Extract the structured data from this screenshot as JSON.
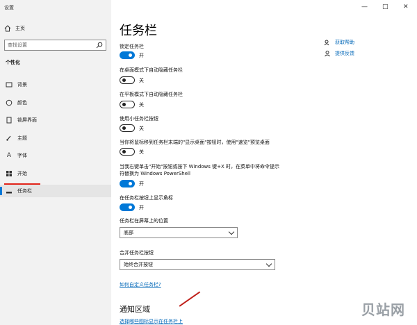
{
  "window": {
    "title": "设置",
    "controls": [
      "—",
      "□",
      "✕"
    ]
  },
  "sidebar": {
    "home_label": "主页",
    "search_placeholder": "查找设置",
    "section_label": "个性化",
    "items": [
      {
        "label": "背景",
        "icon": "picture-icon"
      },
      {
        "label": "颜色",
        "icon": "palette-icon"
      },
      {
        "label": "锁屏界面",
        "icon": "lock-screen-icon"
      },
      {
        "label": "主题",
        "icon": "brush-icon"
      },
      {
        "label": "字体",
        "icon": "font-icon"
      },
      {
        "label": "开始",
        "icon": "start-icon"
      },
      {
        "label": "任务栏",
        "icon": "taskbar-icon",
        "selected": true
      }
    ]
  },
  "main": {
    "title": "任务栏",
    "settings": [
      {
        "label": "锁定任务栏",
        "state": "开",
        "on": true
      },
      {
        "label": "在桌面模式下自动隐藏任务栏",
        "state": "关",
        "on": false
      },
      {
        "label": "在平板模式下自动隐藏任务栏",
        "state": "关",
        "on": false
      },
      {
        "label": "使用小任务栏按钮",
        "state": "关",
        "on": false
      },
      {
        "label": "当你将鼠标移到任务栏末端的\"显示桌面\"按钮时，使用\"速览\"预览桌面",
        "state": "关",
        "on": false
      },
      {
        "label_line1": "当我右键单击\"开始\"按钮或按下 Windows 键+X 时，在菜单中将命令提示",
        "label_line2": "符替换为 Windows PowerShell",
        "state": "开",
        "on": true
      },
      {
        "label": "在任务栏按钮上显示角标",
        "state": "开",
        "on": true
      }
    ],
    "position": {
      "label": "任务栏在屏幕上的位置",
      "value": "底部"
    },
    "combine": {
      "label": "合并任务栏按钮",
      "value": "始终合并按钮"
    },
    "customize_link": "如何自定义任务栏?",
    "notification_heading": "通知区域",
    "notification_link": "选择哪些图标显示在任务栏上"
  },
  "right_links": [
    {
      "label": "获取帮助",
      "icon": "help-icon"
    },
    {
      "label": "提供反馈",
      "icon": "feedback-icon"
    }
  ],
  "watermark": "贝站网"
}
